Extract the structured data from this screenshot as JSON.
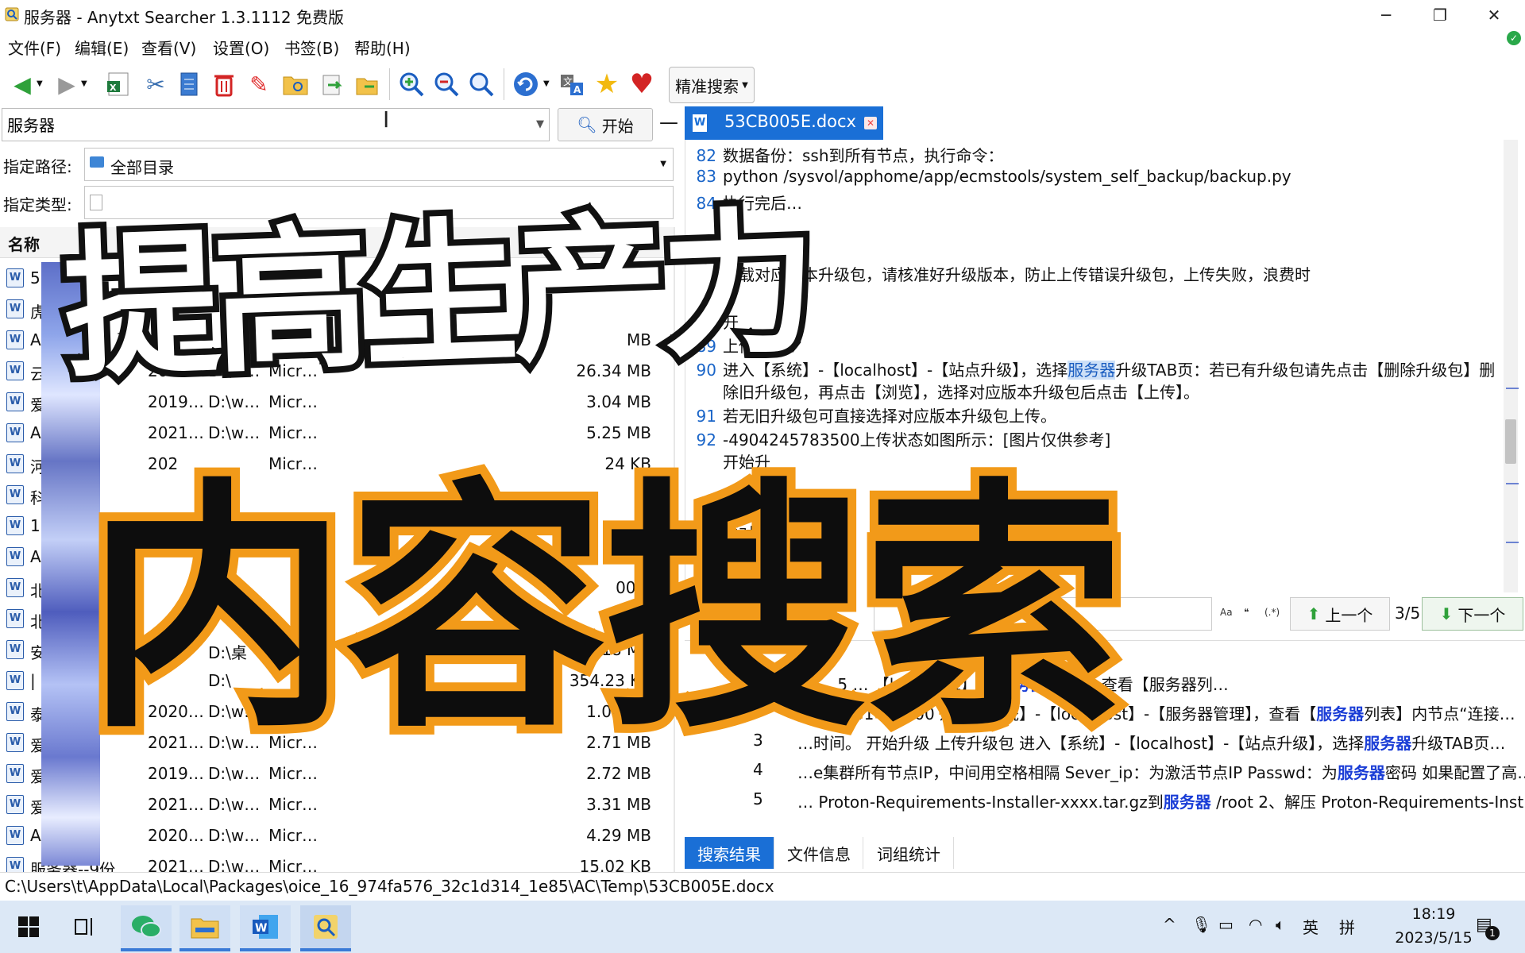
{
  "window": {
    "title": "服务器 - Anytxt Searcher 1.3.1112 免费版",
    "minimize": "─",
    "restore": "❐",
    "close": "✕"
  },
  "menu": [
    "文件(F)",
    "编辑(E)",
    "查看(V)",
    "设置(O)",
    "书签(B)",
    "帮助(H)"
  ],
  "toolbar": {
    "precise_search": "精准搜索",
    "icons": [
      "back-icon",
      "forward-icon",
      "excel-export-icon",
      "cut-icon",
      "copy-icon",
      "delete-icon",
      "clean-icon",
      "open-folder-icon",
      "export-icon",
      "import-icon",
      "zoom-in-icon",
      "zoom-out-icon",
      "zoom-reset-icon",
      "refresh-icon",
      "translate-icon",
      "favorite-star-icon",
      "heart-icon"
    ]
  },
  "search": {
    "query": "服务器",
    "start_label": "开始",
    "path_label": "指定路径:",
    "path_value": "全部目录",
    "type_label": "指定类型:"
  },
  "list": {
    "header_name": "名称",
    "rows": [
      {
        "name": "5",
        "date": "",
        "path": "",
        "app": "",
        "size": ""
      },
      {
        "name": "虎",
        "date": "",
        "path": "",
        "app": "",
        "size": ""
      },
      {
        "name": "A",
        "date": "",
        "path": "",
        "app": "",
        "size": "MB"
      },
      {
        "name": "云 案护…",
        "date": "2021…",
        "path": "D:\\w…",
        "app": "Micr…",
        "size": "26.34 MB"
      },
      {
        "name": "爱 pac…",
        "date": "2019…",
        "path": "D:\\w…",
        "app": "Micr…",
        "size": "3.04 MB"
      },
      {
        "name": "A up …",
        "date": "2021…",
        "path": "D:\\w…",
        "app": "Micr…",
        "size": "5.25 MB"
      },
      {
        "name": "河 机械…",
        "date": "202",
        "path": "",
        "app": "Micr…",
        "size": "24 KB"
      },
      {
        "name": "科",
        "date": "",
        "path": "",
        "app": "",
        "size": ""
      },
      {
        "name": "1",
        "date": "",
        "path": "",
        "app": "",
        "size": ""
      },
      {
        "name": "A",
        "date": "",
        "path": "",
        "app": "",
        "size": ""
      },
      {
        "name": "北",
        "date": "",
        "path": "",
        "app": "",
        "size": "00 K"
      },
      {
        "name": "北",
        "date": "",
        "path": "",
        "app": "",
        "size": "0 K"
      },
      {
        "name": "安",
        "date": "",
        "path": "D:\\桌",
        "app": "",
        "size": "18 MB"
      },
      {
        "name": "|",
        "date": "",
        "path": "D:\\",
        "app": "",
        "size": "354.23 KB"
      },
      {
        "name": "泰 春灾…",
        "date": "2020…",
        "path": "D:\\w…",
        "app": "Micr…",
        "size": "1.06 MB"
      },
      {
        "name": "爱 ack…",
        "date": "2021…",
        "path": "D:\\w…",
        "app": "Micr…",
        "size": "2.71 MB"
      },
      {
        "name": "爱 ack…",
        "date": "2019…",
        "path": "D:\\w…",
        "app": "Micr…",
        "size": "2.72 MB"
      },
      {
        "name": "爱 实施…",
        "date": "2021…",
        "path": "D:\\w…",
        "app": "Micr…",
        "size": "3.31 MB"
      },
      {
        "name": "A up …",
        "date": "2020…",
        "path": "D:\\w…",
        "app": "Micr…",
        "size": "4.29 MB"
      },
      {
        "name": "服务器--9份…",
        "date": "2021…",
        "path": "D:\\w…",
        "app": "Micr…",
        "size": "15.02 KB"
      }
    ]
  },
  "document": {
    "tab_name": "53CB005E.docx",
    "lines": [
      {
        "n": "82",
        "text": "数据备份：ssh到所有节点，执行命令："
      },
      {
        "n": "83",
        "text": "python /sysvol/apphome/app/ecmstools/system_self_backup/backup.py"
      },
      {
        "n": "84",
        "text": "执行完后…"
      },
      {
        "n": "",
        "text": "下载对应版本升级包，请核准好升级版本，防止上传错误升级包，上传失败，浪费时"
      },
      {
        "n": "88",
        "text": "开"
      },
      {
        "n": "89",
        "text": "上传"
      },
      {
        "n": "90",
        "pre": "进入【系统】-【localhost】-【站点升级】，选择",
        "hl": "服务器",
        "post": "升级TAB页：若已有升级包请先点击【删除升级包】删"
      },
      {
        "n": "",
        "text": "除旧升级包，再点击【浏览】，选择对应版本升级包后点击【上传】。"
      },
      {
        "n": "91",
        "text": "若无旧升级包可直接选择对应版本升级包上传。"
      },
      {
        "n": "92",
        "text": "-4904245783500上传状态如图所示：[图片仅供参考]"
      },
      {
        "n": "",
        "text": "开始升"
      },
      {
        "n": "",
        "text": "弹出                                     下："
      },
      {
        "n": "",
        "text": "要对                                     面。"
      }
    ]
  },
  "find": {
    "opt_case": "Aa",
    "opt_word": "❝",
    "opt_regex": "(.*)",
    "prev": "上一个",
    "count": "3/5",
    "next": "下一个"
  },
  "results": [
    {
      "num": "",
      "segments": [
        {
          "t": "常”。5 …                    【localhost】-【"
        },
        {
          "t": "服务器",
          "k": true
        },
        {
          "t": "管理】，查看【服务器列…"
        }
      ]
    },
    {
      "num": "2",
      "segments": [
        {
          "t": "…260301449500 进入【系统】-【localhost】-【服务器管理】，查看【"
        },
        {
          "t": "服务器",
          "k": true
        },
        {
          "t": "列表】内节点“连接…"
        }
      ]
    },
    {
      "num": "3",
      "segments": [
        {
          "t": "…时间。 开始升级 上传升级包 进入【系统】-【localhost】-【站点升级】，选择"
        },
        {
          "t": "服务器",
          "k": true
        },
        {
          "t": "升级TAB页…"
        }
      ]
    },
    {
      "num": "4",
      "segments": [
        {
          "t": "…e集群所有节点IP，中间用空格相隔 Sever_ip：为激活节点IP Passwd：为"
        },
        {
          "t": "服务器",
          "k": true
        },
        {
          "t": "密码 如果配置了高…"
        }
      ]
    },
    {
      "num": "5",
      "segments": [
        {
          "t": "… Proton-Requirements-Installer-xxxx.tar.gz到"
        },
        {
          "t": "服务器",
          "k": true
        },
        {
          "t": " /root 2、解压 Proton-Requirements-Inst…"
        }
      ]
    }
  ],
  "bottom_tabs": [
    "搜索结果",
    "文件信息",
    "词组统计"
  ],
  "status_path": "C:\\Users\\t\\AppData\\Local\\Packages\\oice_16_974fa576_32c1d314_1e85\\AC\\Temp\\53CB005E.docx",
  "overlay": {
    "line1": "提高生产力",
    "line2": "内容搜索"
  },
  "taskbar": {
    "lang": "英",
    "ime": "拼",
    "time": "18:19",
    "date": "2023/5/15",
    "notifications": "1"
  },
  "colors": {
    "accent": "#1a6fd6",
    "highlight_kw": "#1a3dd6",
    "overlay_orange": "#f29a19"
  }
}
